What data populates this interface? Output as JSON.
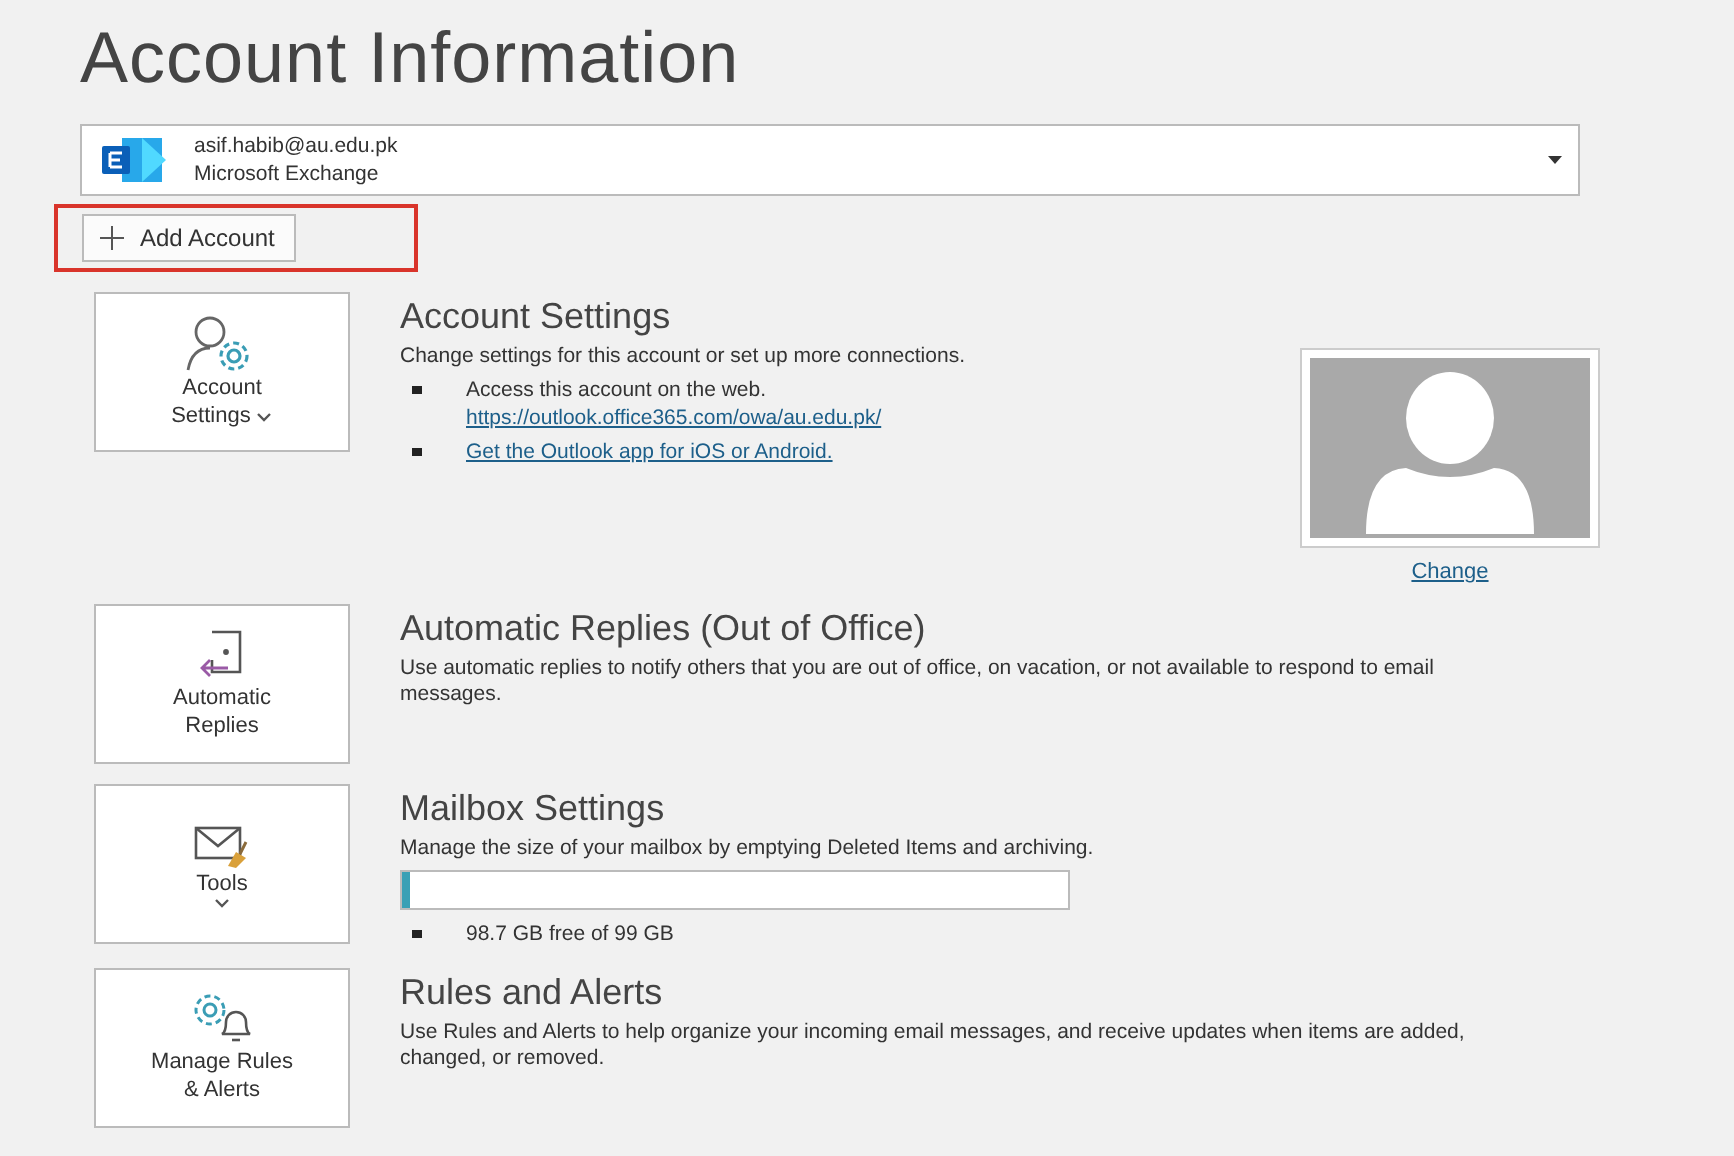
{
  "title": "Account Information",
  "account": {
    "email": "asif.habib@au.edu.pk",
    "type": "Microsoft Exchange"
  },
  "add_account": {
    "label": "Add Account",
    "highlighted": true
  },
  "sections": [
    {
      "kind": "account",
      "tile_label": "Account Settings",
      "dropdown": true,
      "title": "Account Settings",
      "description": "Change settings for this account or set up more connections.",
      "bullets": [
        {
          "text": "Access this account on the web.",
          "link": "https://outlook.office365.com/owa/au.edu.pk/"
        },
        {
          "link": "Get the Outlook app for iOS or Android."
        }
      ],
      "photo": {
        "link": "Change"
      }
    },
    {
      "kind": "plain",
      "tile_label": "Automatic Replies",
      "dropdown": false,
      "title": "Automatic Replies (Out of Office)",
      "description": "Use automatic replies to notify others that you are out of office, on vacation, or not available to respond to email messages."
    },
    {
      "kind": "storage",
      "tile_label": "Tools",
      "dropdown": true,
      "title": "Mailbox Settings",
      "description": "Manage the size of your mailbox by emptying Deleted Items and archiving.",
      "level": 0.013,
      "bullets": [
        {
          "text": "98.7 GB free of 99 GB"
        }
      ]
    },
    {
      "kind": "plain",
      "tile_label": "Manage Rules & Alerts",
      "dropdown": false,
      "title": "Rules and Alerts",
      "description": "Use Rules and Alerts to help organize your incoming email messages, and receive updates when items are added, changed, or removed."
    }
  ]
}
